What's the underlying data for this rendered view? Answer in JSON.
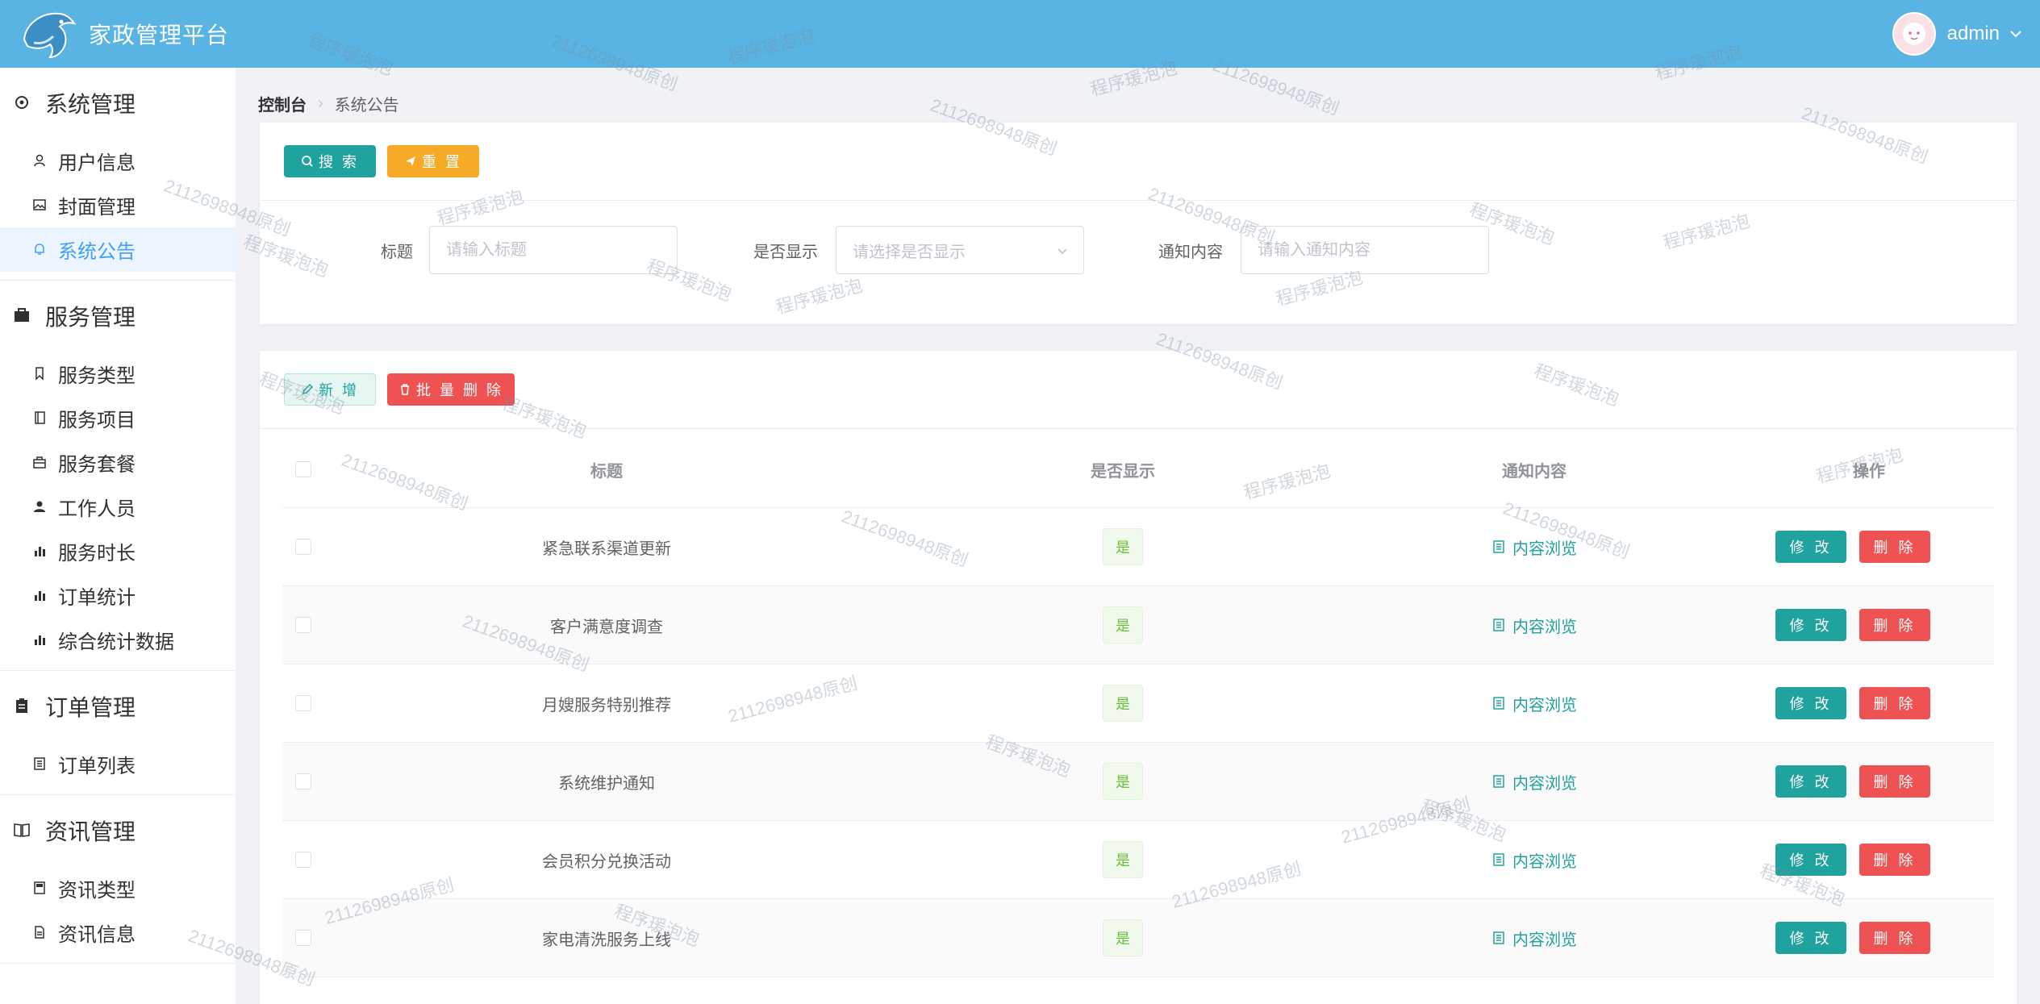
{
  "header": {
    "app_title": "家政管理平台",
    "user_name": "admin"
  },
  "sidebar": {
    "groups": [
      {
        "title": "系统管理",
        "icon": "settings-icon",
        "items": [
          {
            "label": "用户信息",
            "icon": "user-icon"
          },
          {
            "label": "封面管理",
            "icon": "image-icon"
          },
          {
            "label": "系统公告",
            "icon": "bell-icon",
            "active": true
          }
        ]
      },
      {
        "title": "服务管理",
        "icon": "briefcase-icon",
        "items": [
          {
            "label": "服务类型",
            "icon": "bookmark-icon"
          },
          {
            "label": "服务项目",
            "icon": "notebook-icon"
          },
          {
            "label": "服务套餐",
            "icon": "package-icon"
          },
          {
            "label": "工作人员",
            "icon": "person-icon"
          },
          {
            "label": "服务时长",
            "icon": "bar-chart-icon"
          },
          {
            "label": "订单统计",
            "icon": "bar-chart-icon"
          },
          {
            "label": "综合统计数据",
            "icon": "bar-chart-icon"
          }
        ]
      },
      {
        "title": "订单管理",
        "icon": "clipboard-icon",
        "items": [
          {
            "label": "订单列表",
            "icon": "list-icon"
          }
        ]
      },
      {
        "title": "资讯管理",
        "icon": "book-icon",
        "items": [
          {
            "label": "资讯类型",
            "icon": "folder-icon"
          },
          {
            "label": "资讯信息",
            "icon": "document-icon"
          }
        ]
      }
    ]
  },
  "breadcrumb": {
    "root": "控制台",
    "current": "系统公告"
  },
  "search": {
    "search_label": "搜 索",
    "reset_label": "重 置",
    "title_label": "标题",
    "title_placeholder": "请输入标题",
    "show_label": "是否显示",
    "show_placeholder": "请选择是否显示",
    "content_label": "通知内容",
    "content_placeholder": "请输入通知内容"
  },
  "toolbar": {
    "add_label": "新 增",
    "batch_delete_label": "批 量 删 除"
  },
  "table": {
    "headers": {
      "title": "标题",
      "show": "是否显示",
      "content": "通知内容",
      "ops": "操作"
    },
    "view_label": "内容浏览",
    "edit_label": "修 改",
    "delete_label": "删 除",
    "rows": [
      {
        "title": "紧急联系渠道更新",
        "show": "是"
      },
      {
        "title": "客户满意度调查",
        "show": "是"
      },
      {
        "title": "月嫂服务特别推荐",
        "show": "是"
      },
      {
        "title": "系统维护通知",
        "show": "是"
      },
      {
        "title": "会员积分兑换活动",
        "show": "是"
      },
      {
        "title": "家电清洗服务上线",
        "show": "是"
      }
    ]
  },
  "watermarks": {
    "text_a": "程序瑗泡泡",
    "text_b": "2112698948原创"
  },
  "colors": {
    "header": "#5ab4e3",
    "primary": "#20a39e",
    "danger": "#ee5252",
    "warning": "#f7a928",
    "active": "#409eff"
  }
}
